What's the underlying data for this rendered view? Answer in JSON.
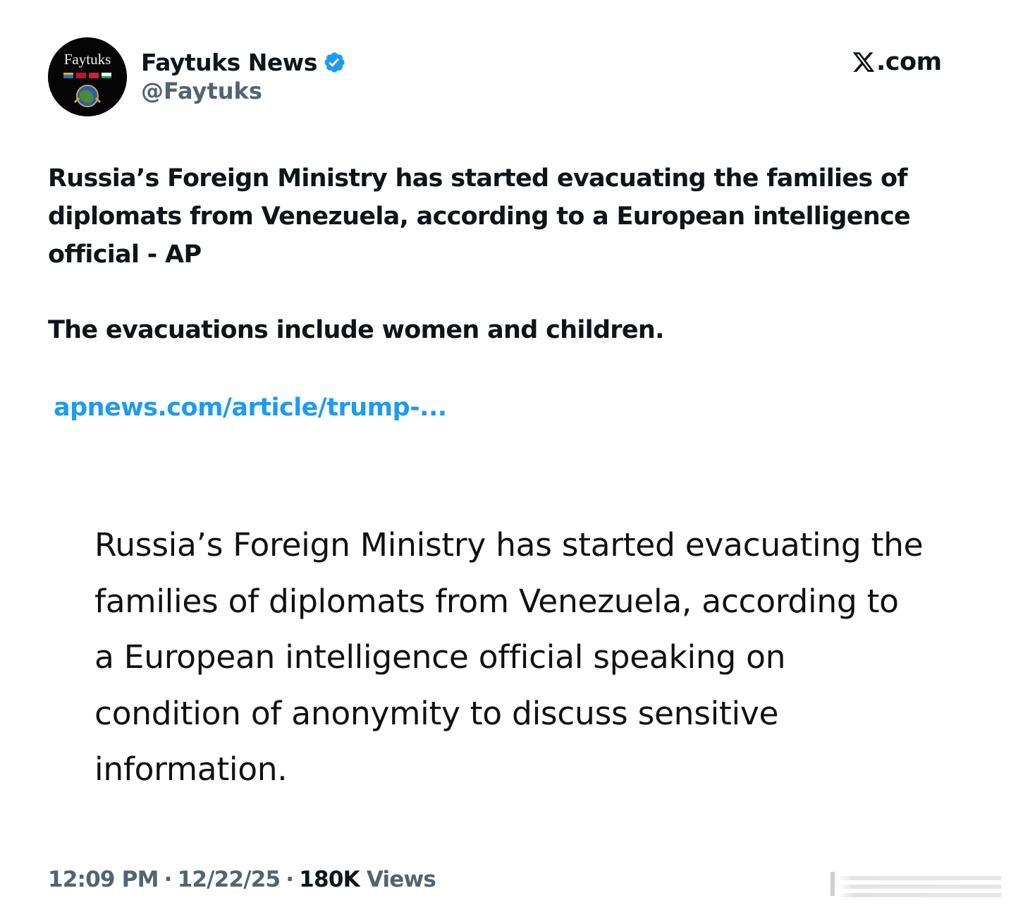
{
  "author": {
    "name": "Faytuks News",
    "handle": "@Faytuks",
    "avatar_text": "Faytuks",
    "verified": true
  },
  "brand": {
    "text": ".com",
    "icon": "x-logo-icon"
  },
  "tweet": {
    "paragraphs": [
      "Russia’s Foreign Ministry has started evacuating the families of diplomats from Venezuela, according to a European intelligence official - AP",
      "The evacuations include women and children."
    ],
    "link": "apnews.com/article/trump-..."
  },
  "quote_image": {
    "text": "Russia’s Foreign Ministry has started evacuating the families of diplomats from Venezuela, according to a European intelligence official speaking on condition of anonymity to discuss sensitive information."
  },
  "meta": {
    "time": "12:09 PM",
    "date": "12/22/25",
    "views_count": "180K",
    "views_label": "Views",
    "separator": "·"
  },
  "colors": {
    "text": "#0f1419",
    "secondary": "#536471",
    "link": "#1d9bf0",
    "verified": "#1d9bf0"
  }
}
